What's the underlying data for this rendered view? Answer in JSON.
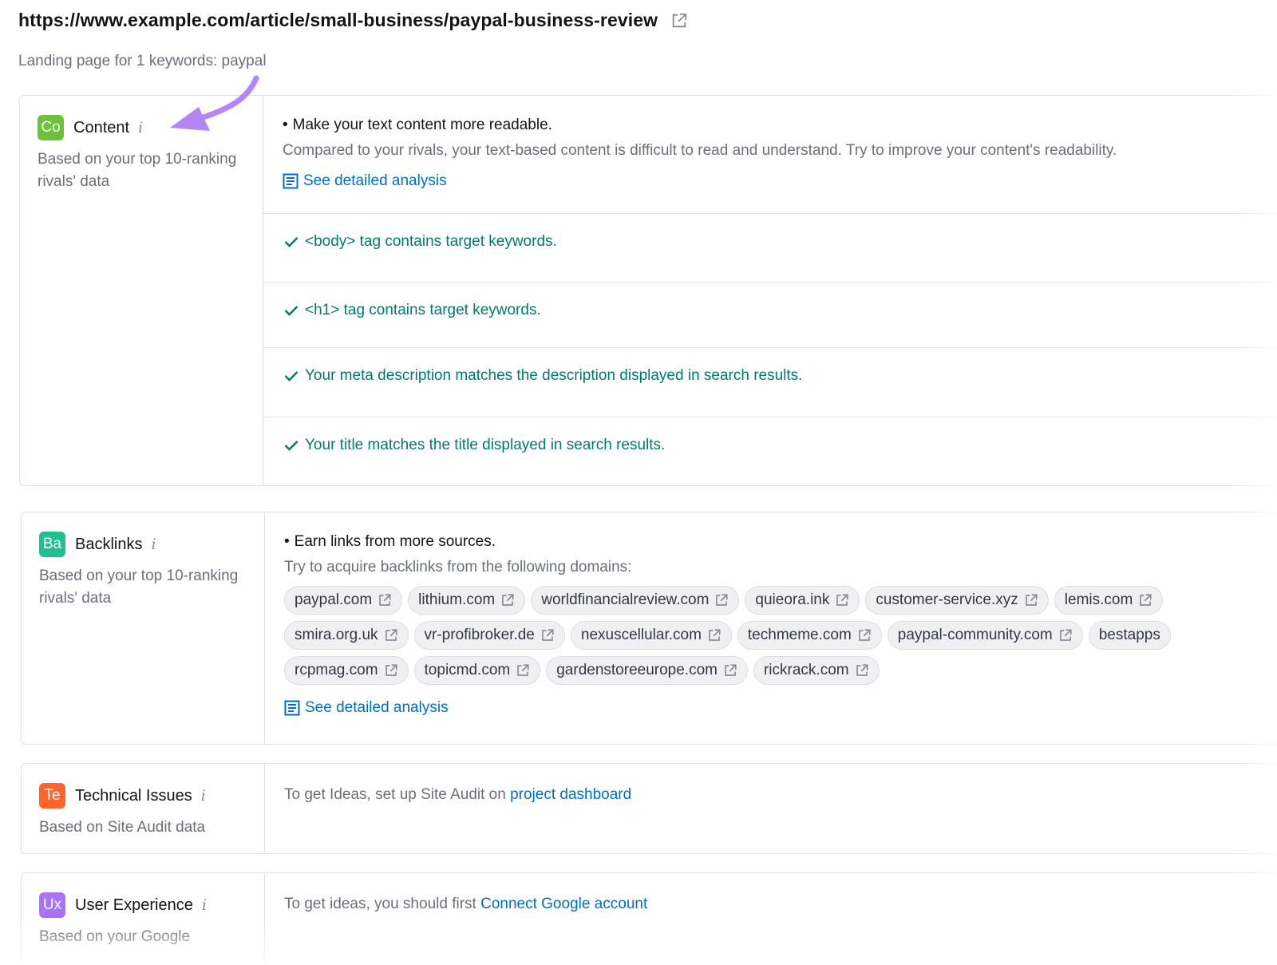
{
  "header": {
    "url": "https://www.example.com/article/small-business/paypal-business-review",
    "subtitle": "Landing page for 1 keywords: paypal"
  },
  "colors": {
    "content_badge": "#6cc33b",
    "backlinks_badge": "#1fbf8f",
    "technical_badge": "#ff642d",
    "ux_badge": "#a972f7",
    "link": "#006dca",
    "success": "#007c65",
    "arrow": "#b585f5"
  },
  "categories": {
    "content": {
      "badge": "Co",
      "name": "Content",
      "info": "i",
      "desc": "Based on your top 10-ranking rivals' data",
      "idea": {
        "title": "Make your text content more readable.",
        "desc": "Compared to your rivals, your text-based content is difficult to read and understand. Try to improve your content's readability.",
        "link": "See detailed analysis"
      },
      "checks": [
        "<body> tag contains target keywords.",
        "<h1> tag contains target keywords.",
        "Your meta description matches the description displayed in search results.",
        "Your title matches the title displayed in search results."
      ]
    },
    "backlinks": {
      "badge": "Ba",
      "name": "Backlinks",
      "info": "i",
      "desc": "Based on your top 10-ranking rivals' data",
      "idea": {
        "title": "Earn links from more sources.",
        "desc": "Try to acquire backlinks from the following domains:",
        "link": "See detailed analysis"
      },
      "domains_row1": [
        "paypal.com",
        "lithium.com",
        "worldfinancialreview.com",
        "quieora.ink",
        "customer-service.xyz",
        "lemis.com"
      ],
      "domains_row2": [
        "smira.org.uk",
        "vr-profibroker.de",
        "nexuscellular.com",
        "techmeme.com",
        "paypal-community.com",
        "bestapps"
      ],
      "domains_row3": [
        "rcpmag.com",
        "topicmd.com",
        "gardenstoreeurope.com",
        "rickrack.com"
      ]
    },
    "technical": {
      "badge": "Te",
      "name": "Technical Issues",
      "info": "i",
      "desc": "Based on Site Audit data",
      "text": "To get Ideas, set up Site Audit on ",
      "link": "project dashboard"
    },
    "ux": {
      "badge": "Ux",
      "name": "User Experience",
      "info": "i",
      "desc": "Based on your Google",
      "text": "To get ideas, you should first ",
      "link": "Connect Google account"
    }
  }
}
